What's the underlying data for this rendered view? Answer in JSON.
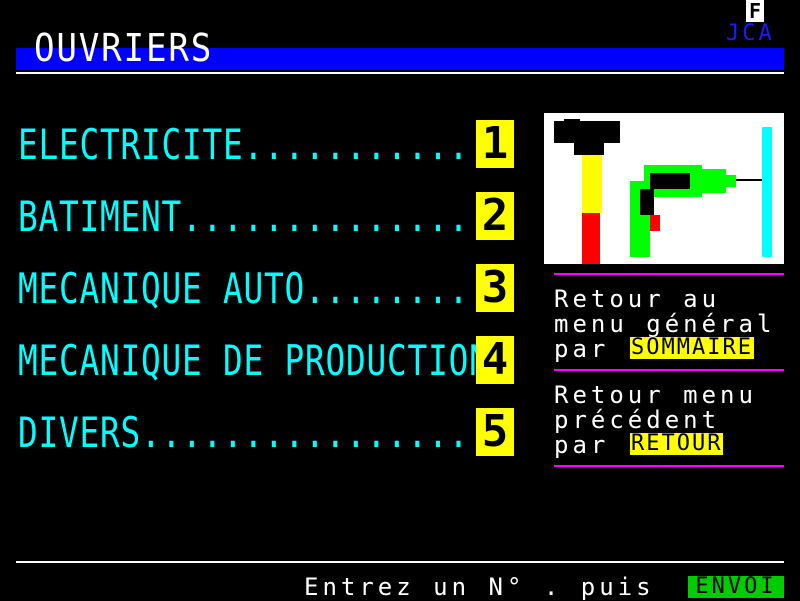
{
  "header": {
    "corner_letter": "F",
    "corner_code": "JCA",
    "title": "OUVRIERS"
  },
  "menu": {
    "items": [
      {
        "label": "ELECTRICITE",
        "dots": "............",
        "number": "1"
      },
      {
        "label": "BATIMENT",
        "dots": "...............",
        "number": "2"
      },
      {
        "label": "MECANIQUE AUTO",
        "dots": ".........",
        "number": "3"
      },
      {
        "label": "MECANIQUE DE PRODUCTION",
        "dots": ".",
        "number": "4"
      },
      {
        "label": "DIVERS",
        "dots": ".................",
        "number": "5"
      }
    ]
  },
  "illustration": {
    "hammer_icon": "hammer-icon",
    "drill_icon": "drill-icon"
  },
  "info": {
    "sommaire": {
      "line1": "Retour au",
      "line2": "menu général",
      "line3_prefix": "par",
      "key": "SOMMAIRE"
    },
    "retour": {
      "line1": "Retour menu",
      "line2": "précédent",
      "line3_prefix": "par",
      "key": "RETOUR"
    }
  },
  "footer": {
    "prompt": "Entrez un N° . puis",
    "key": "ENVOI"
  },
  "colors": {
    "background": "#000000",
    "title_bar": "#0000ff",
    "menu_text": "#00ffff",
    "number_box": "#ffff00",
    "separator": "#ff00ff",
    "envoi": "#00cc00"
  }
}
